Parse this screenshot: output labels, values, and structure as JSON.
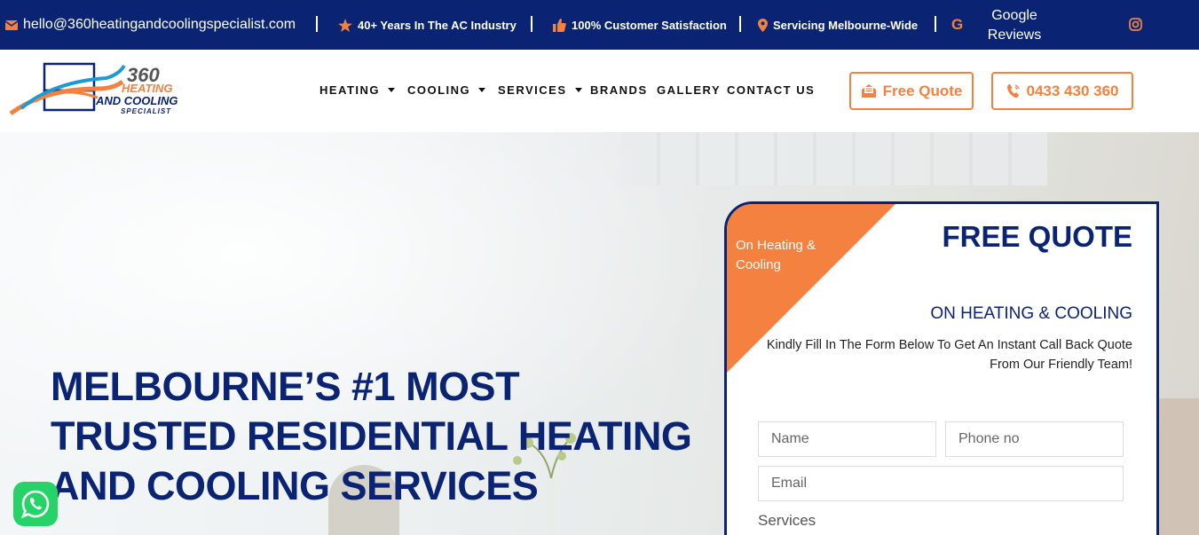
{
  "topbar": {
    "email": "hello@360heatingandcoolingspecialist.com",
    "years": "40+ Years In The AC Industry",
    "satisfaction": "100% Customer Satisfaction",
    "servicing": "Servicing Melbourne-Wide",
    "google_letter": "G",
    "reviews_line1": "Google",
    "reviews_line2": "Reviews"
  },
  "logo": {
    "line1": "360",
    "line2": "HEATING",
    "line3": "AND COOLING",
    "line4": "SPECIALIST"
  },
  "nav": {
    "items": [
      {
        "label": "HEATING",
        "dropdown": true
      },
      {
        "label": "COOLING",
        "dropdown": true
      },
      {
        "label": "SERVICES",
        "dropdown": true
      },
      {
        "label": "BRANDS",
        "dropdown": false
      },
      {
        "label": "GALLERY",
        "dropdown": false
      },
      {
        "label": "CONTACT US",
        "dropdown": false
      }
    ],
    "quote_button": "Free Quote",
    "phone_button": "0433 430 360"
  },
  "hero": {
    "title": "MELBOURNE’S #1 MOST TRUSTED RESIDENTIAL HEATING AND COOLING SERVICES"
  },
  "quote_card": {
    "corner_text": "On Heating & Cooling",
    "title": "FREE QUOTE",
    "subtitle": "ON HEATING & COOLING",
    "description": "Kindly Fill In The Form Below To Get An Instant Call Back Quote From Our Friendly Team!",
    "name_placeholder": "Name",
    "phone_placeholder": "Phone no",
    "email_placeholder": "Email",
    "services_label": "Services"
  },
  "colors": {
    "navy": "#0a2473",
    "orange": "#f4813f",
    "whatsapp": "#25d366"
  }
}
